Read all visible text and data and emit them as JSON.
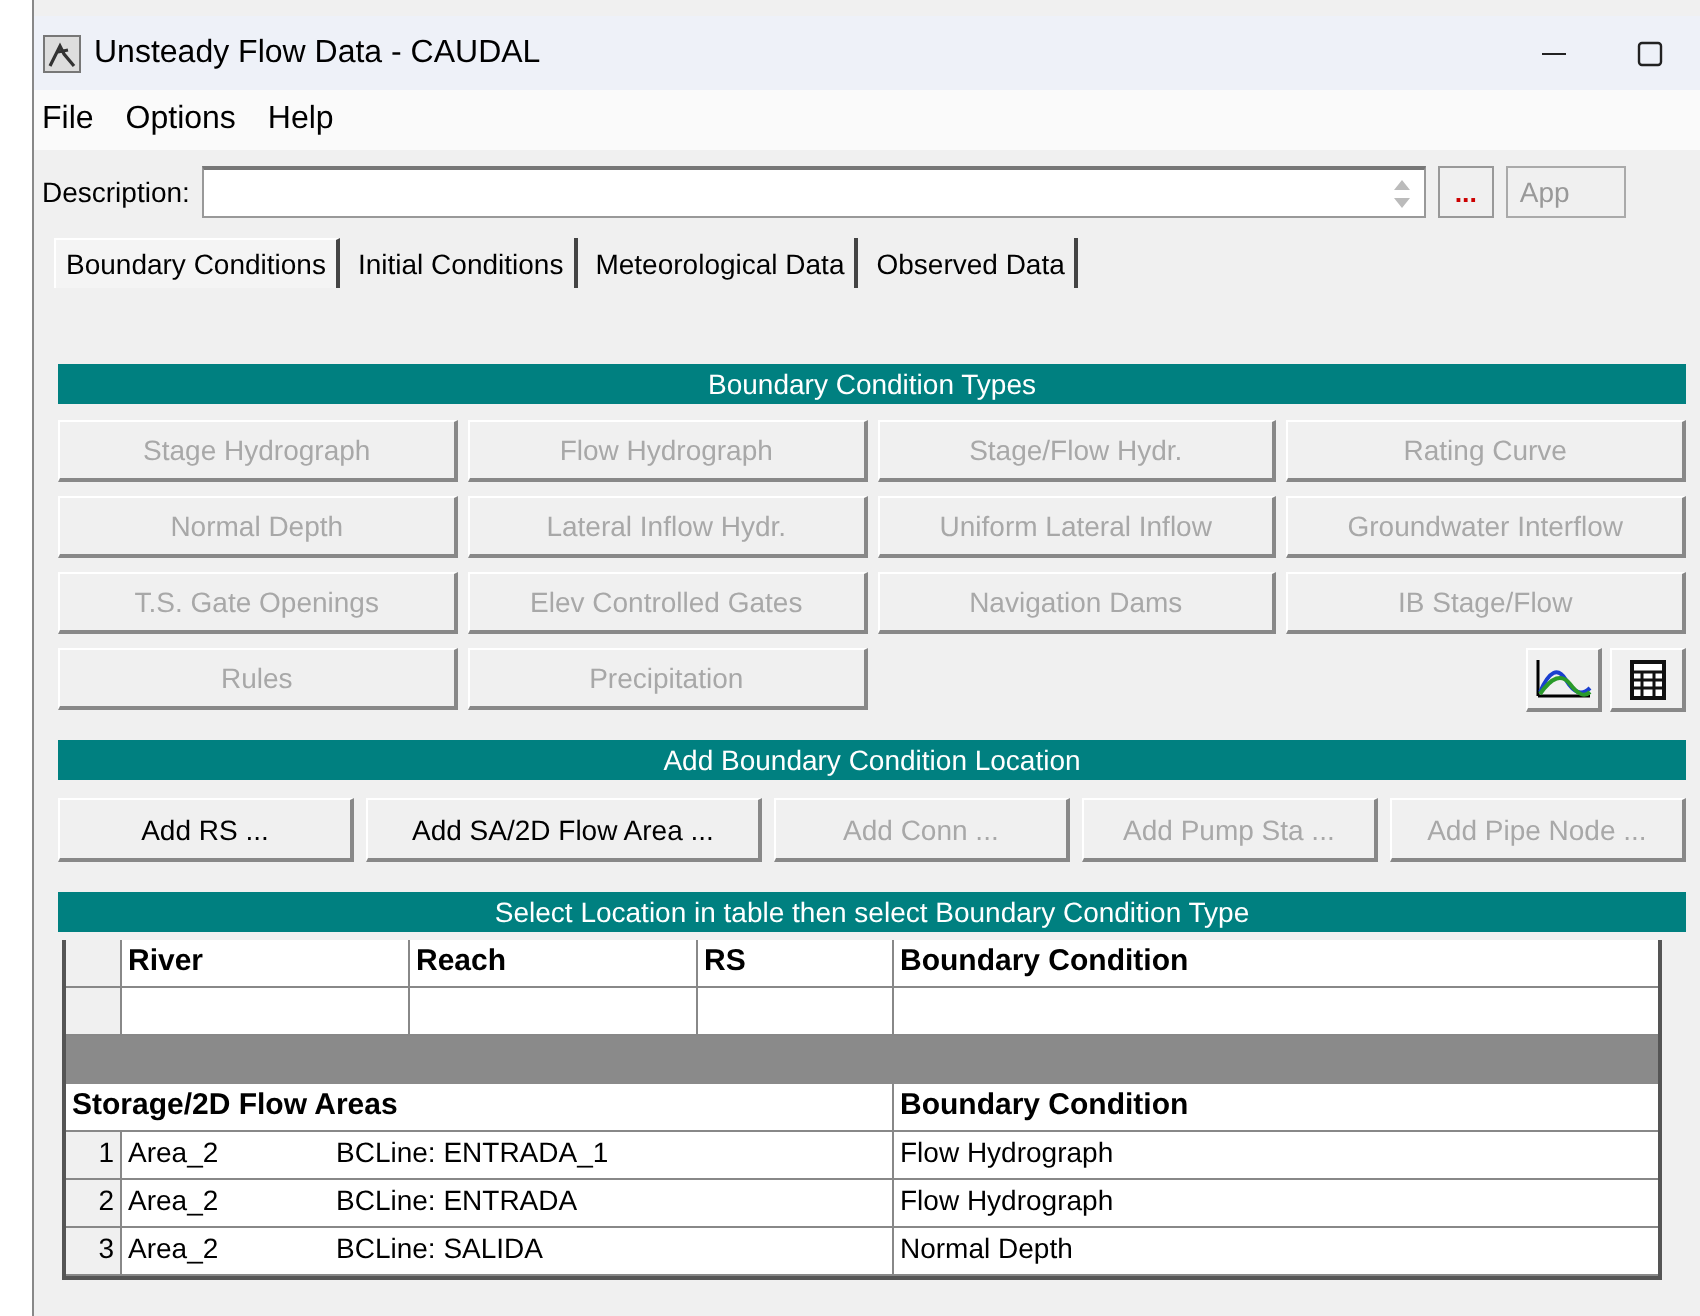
{
  "window": {
    "title": "Unsteady Flow Data - CAUDAL"
  },
  "menu": [
    "File",
    "Options",
    "Help"
  ],
  "description": {
    "label": "Description:",
    "browse": "...",
    "apply": "App"
  },
  "tabs": [
    {
      "label": "Boundary Conditions",
      "selected": true
    },
    {
      "label": "Initial Conditions",
      "selected": false
    },
    {
      "label": "Meteorological Data",
      "selected": false
    },
    {
      "label": "Observed Data",
      "selected": false
    }
  ],
  "bc_types": {
    "title": "Boundary Condition Types",
    "buttons": [
      {
        "label": "Stage Hydrograph",
        "disabled": true
      },
      {
        "label": "Flow Hydrograph",
        "disabled": true
      },
      {
        "label": "Stage/Flow Hydr.",
        "disabled": true
      },
      {
        "label": "Rating Curve",
        "disabled": true
      },
      {
        "label": "Normal Depth",
        "disabled": true
      },
      {
        "label": "Lateral Inflow Hydr.",
        "disabled": true
      },
      {
        "label": "Uniform Lateral Inflow",
        "disabled": true
      },
      {
        "label": "Groundwater Interflow",
        "disabled": true
      },
      {
        "label": "T.S. Gate Openings",
        "disabled": true
      },
      {
        "label": "Elev Controlled Gates",
        "disabled": true
      },
      {
        "label": "Navigation Dams",
        "disabled": true
      },
      {
        "label": "IB Stage/Flow",
        "disabled": true
      },
      {
        "label": "Rules",
        "disabled": true
      },
      {
        "label": "Precipitation",
        "disabled": true
      }
    ]
  },
  "location": {
    "title": "Add Boundary Condition Location",
    "buttons": [
      {
        "label": "Add RS ...",
        "disabled": false
      },
      {
        "label": "Add SA/2D Flow Area ...",
        "disabled": false
      },
      {
        "label": "Add Conn ...",
        "disabled": true
      },
      {
        "label": "Add Pump Sta ...",
        "disabled": true
      },
      {
        "label": "Add Pipe Node ...",
        "disabled": true
      }
    ]
  },
  "table": {
    "title": "Select Location in table then select Boundary Condition Type",
    "columns": [
      "River",
      "Reach",
      "RS",
      "Boundary Condition"
    ],
    "area_columns": [
      "Storage/2D Flow Areas",
      "Boundary Condition"
    ],
    "area_rows": [
      {
        "index": "1",
        "area": "Area_2",
        "bcline": "BCLine: ENTRADA_1",
        "condition": "Flow Hydrograph"
      },
      {
        "index": "2",
        "area": "Area_2",
        "bcline": "BCLine: ENTRADA",
        "condition": "Flow Hydrograph"
      },
      {
        "index": "3",
        "area": "Area_2",
        "bcline": "BCLine: SALIDA",
        "condition": "Normal Depth"
      }
    ]
  }
}
